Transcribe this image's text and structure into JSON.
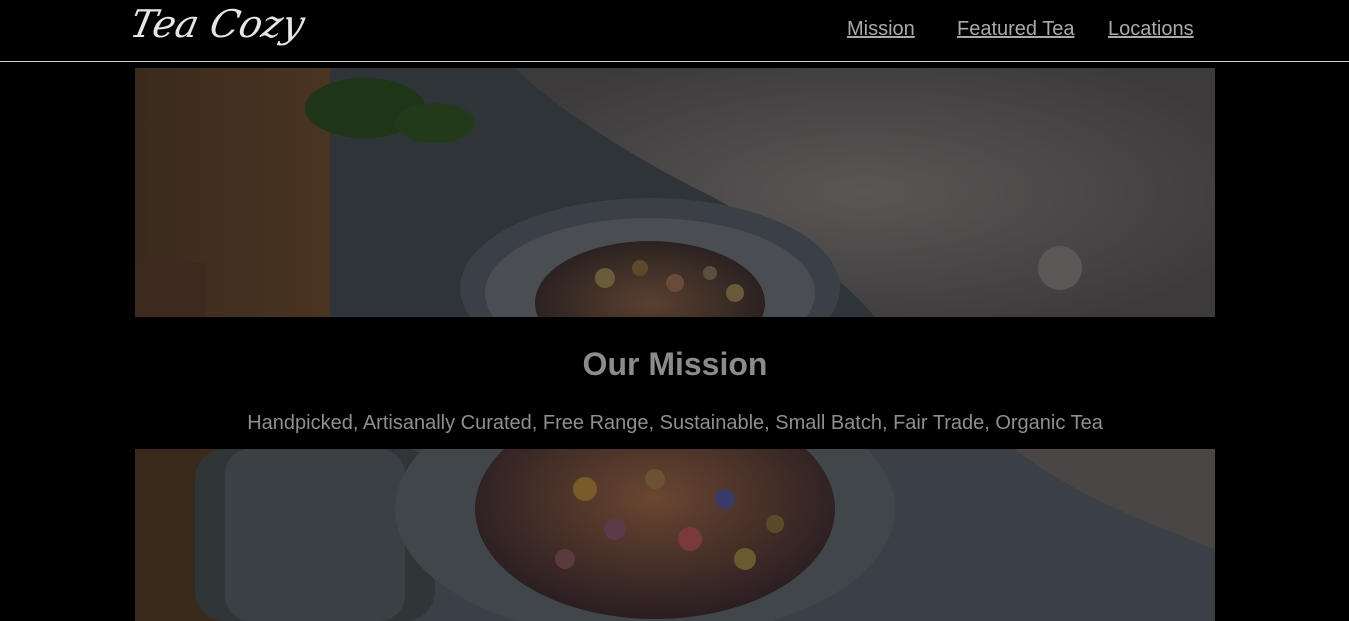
{
  "header": {
    "logo": "Tea Cozy",
    "nav": [
      {
        "label": "Mission"
      },
      {
        "label": "Featured Tea"
      },
      {
        "label": "Locations"
      }
    ]
  },
  "mission": {
    "title": "Our Mission",
    "tagline": "Handpicked, Artisanally Curated, Free Range, Sustainable, Small Batch, Fair Trade, Organic Tea"
  },
  "colors": {
    "background": "#000000",
    "nav_link": "#a9a9a9",
    "heading": "#8b8b8b"
  }
}
